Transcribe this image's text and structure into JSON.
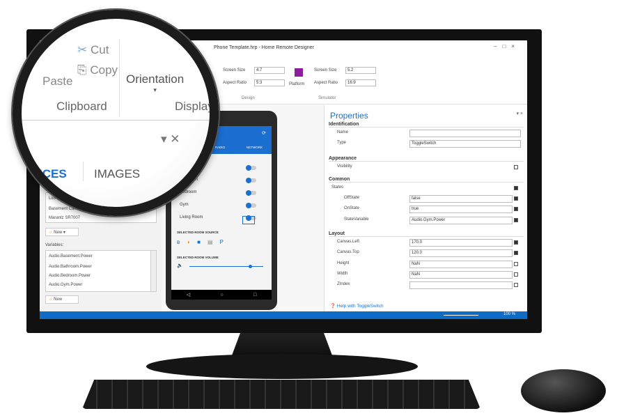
{
  "window": {
    "title": "Phone Template.hrp - Home Remote Designer"
  },
  "ribbon": {
    "design": {
      "screen_size_label": "Screen Size",
      "screen_size": "4.7",
      "aspect_label": "Aspect Ratio",
      "aspect": "5:3",
      "group": "Design"
    },
    "simulator": {
      "platform_label": "Platform",
      "screen_size_label": "Screen Size",
      "screen_size": "5.2",
      "aspect_label": "Aspect Ratio",
      "aspect": "16:9",
      "group": "Simulator"
    }
  },
  "magnifier": {
    "paste": "Paste",
    "cut": "Cut",
    "copy": "Copy",
    "clipboard": "Clipboard",
    "orientation": "Orientation",
    "display": "Display",
    "tab_devices": "ICES",
    "tab_images": "IMAGES"
  },
  "left_panel": {
    "devices": [
      "Living",
      "Basement Camera",
      "Marantz SR7007"
    ],
    "new_label": "New",
    "variables_label": "Variables:",
    "variables": [
      "Audio.Basement.Power",
      "Audio.Bathroom.Power",
      "Audio.Bedroom.Power",
      "Audio.Gym.Power"
    ]
  },
  "phone": {
    "tabs": [
      "HD RADIO",
      "NETWORK"
    ],
    "section_rooms": "CTION",
    "rooms": [
      "asement",
      "Bathroom",
      "Bedroom",
      "Gym",
      "Living Room"
    ],
    "source_label": "SELECTED ROOM SOURCE",
    "volume_label": "SELECTED ROOM VOLUME",
    "volume_level": 0.82
  },
  "properties": {
    "title": "Properties",
    "identification": "Identification",
    "name_label": "Name",
    "name_value": "",
    "type_label": "Type",
    "type_value": "ToggleSwitch",
    "appearance": "Appearance",
    "visibility_label": "Visibility",
    "common": "Common",
    "states_label": "States",
    "offstate_label": "OffState",
    "offstate": "false",
    "onstate_label": "OnState",
    "onstate": "true",
    "statevar_label": "StateVariable",
    "statevar": "Audio.Gym.Power",
    "layout": "Layout",
    "canvas_left_label": "Canvas.Left",
    "canvas_left": "170.0",
    "canvas_top_label": "Canvas.Top",
    "canvas_top": "120.0",
    "height_label": "Height",
    "height": "NaN",
    "width_label": "Width",
    "width": "NaN",
    "zindex_label": "ZIndex",
    "zindex": "",
    "help": "Help with ToggleSwitch"
  },
  "status": {
    "zoom": "100 %"
  },
  "colors": {
    "accent": "#1a6fd1",
    "status_bar": "#0e6cc4"
  }
}
